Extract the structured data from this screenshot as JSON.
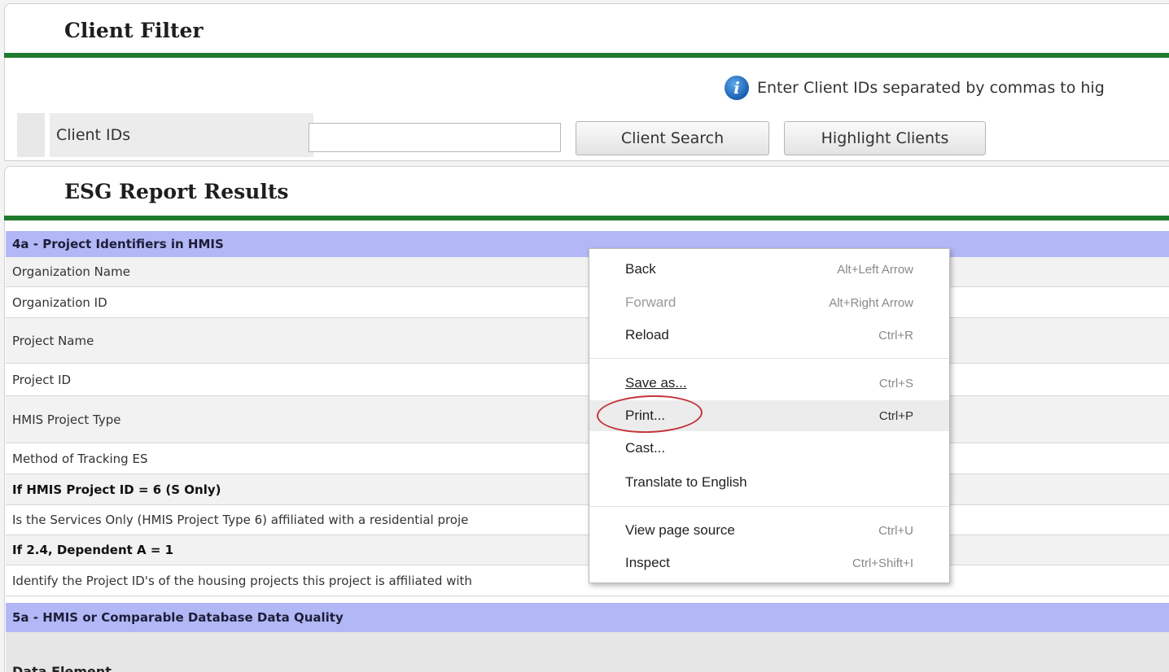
{
  "client_filter": {
    "title": "Client Filter",
    "info_text": "Enter Client IDs separated by commas to hig",
    "label": "Client IDs",
    "input_value": "",
    "search_button": "Client Search",
    "highlight_button": "Highlight Clients"
  },
  "results": {
    "title": "ESG Report Results",
    "section_4a": "4a - Project Identifiers in HMIS",
    "rows": [
      "Organization Name",
      "Organization ID",
      "Project Name",
      "Project ID",
      "HMIS Project Type",
      "Method of Tracking ES",
      "If HMIS Project ID = 6 (S Only)",
      "Is the Services Only (HMIS Project Type 6) affiliated with a residential proje",
      "If 2.4, Dependent A = 1",
      "Identify the Project ID's of the housing projects this project is affiliated with"
    ],
    "section_5a": "5a - HMIS or Comparable Database Data Quality",
    "data_element": "Data Element"
  },
  "context_menu": {
    "items": [
      {
        "label": "Back",
        "shortcut": "Alt+Left Arrow"
      },
      {
        "label": "Forward",
        "shortcut": "Alt+Right Arrow"
      },
      {
        "label": "Reload",
        "shortcut": "Ctrl+R"
      },
      {
        "label": "Save as...",
        "shortcut": "Ctrl+S"
      },
      {
        "label": "Print...",
        "shortcut": "Ctrl+P"
      },
      {
        "label": "Cast...",
        "shortcut": ""
      },
      {
        "label": "Translate to English",
        "shortcut": ""
      },
      {
        "label": "View page source",
        "shortcut": "Ctrl+U"
      },
      {
        "label": "Inspect",
        "shortcut": "Ctrl+Shift+I"
      }
    ]
  },
  "colors": {
    "green_bar": "#1f7a2e",
    "section_header": "#b2b8f5",
    "highlight_circle": "#c4343b"
  }
}
